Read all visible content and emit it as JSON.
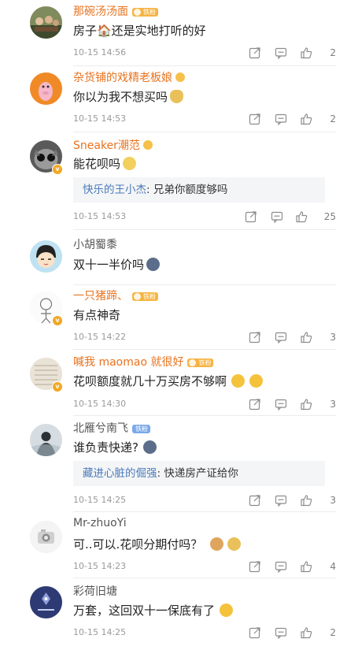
{
  "comments": [
    {
      "name": "那碗汤汤面",
      "fan_label": "铁粉",
      "text": "房子🏠还是实地打听的好",
      "time": "10-15 14:56",
      "likes": "2"
    },
    {
      "name": "杂货铺的戏精老板娘",
      "fan_label": "",
      "text": "你以为我不想买吗",
      "time": "10-15 14:53",
      "likes": "2"
    },
    {
      "name": "Sneaker潮范",
      "fan_label": "",
      "text": "能花呗吗",
      "reply_user": "快乐的王小杰",
      "reply_text": ": 兄弟你额度够吗",
      "time": "10-15 14:53",
      "likes": "25"
    },
    {
      "name": "小胡蜀黍",
      "text": "双十一半价吗"
    },
    {
      "name": "一只猪蹄、",
      "fan_label": "铁粉",
      "text": "有点神奇",
      "time": "10-15 14:22",
      "likes": "3"
    },
    {
      "name": "喊我 maomao 就很好",
      "fan_label": "铁粉",
      "text": "花呗额度就几十万买房不够啊",
      "time": "10-15 14:30",
      "likes": "3"
    },
    {
      "name": "北雁兮南飞",
      "fan_label": "铁粉",
      "text": "谁负责快递?",
      "reply_user": "藏进心脏的倔强",
      "reply_text": ": 快递房产证给你",
      "time": "10-15 14:25",
      "likes": "3"
    },
    {
      "name": "Mr-zhuoYi",
      "text": "可..可以.花呗分期付吗？",
      "time": "10-15 14:23",
      "likes": "4"
    },
    {
      "name": "彩荷旧塘",
      "text": "万套，这回双十一保底有了",
      "time": "10-15 14:25",
      "likes": "2"
    }
  ],
  "icons": {
    "share": "share-icon",
    "comment": "comment-icon",
    "like": "thumbs-up-icon"
  }
}
